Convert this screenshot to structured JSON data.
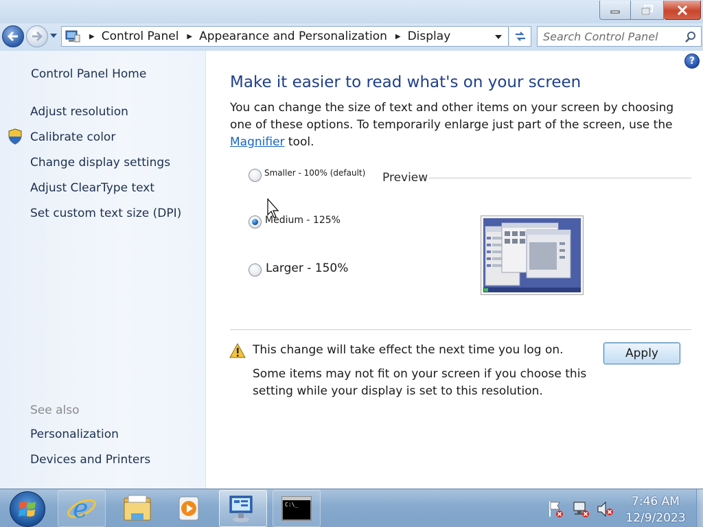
{
  "window": {
    "minimize_icon": "minimize-icon",
    "maximize_icon": "restore-icon",
    "close_icon": "close-icon"
  },
  "address_bar": {
    "breadcrumbs": [
      "Control Panel",
      "Appearance and Personalization",
      "Display"
    ],
    "search_placeholder": "Search Control Panel"
  },
  "sidebar": {
    "home": "Control Panel Home",
    "links": [
      "Adjust resolution",
      "Calibrate color",
      "Change display settings",
      "Adjust ClearType text",
      "Set custom text size (DPI)"
    ],
    "see_also_heading": "See also",
    "see_also_links": [
      "Personalization",
      "Devices and Printers"
    ]
  },
  "main": {
    "title": "Make it easier to read what's on your screen",
    "description_before": "You can change the size of text and other items on your screen by choosing one of these options. To temporarily enlarge just part of the screen, use the ",
    "description_link": "Magnifier",
    "description_after": " tool.",
    "options": [
      {
        "label": "Smaller - 100% (default)",
        "selected": false
      },
      {
        "label": "Medium - 125%",
        "selected": true
      },
      {
        "label": "Larger - 150%",
        "selected": false
      }
    ],
    "preview_label": "Preview",
    "warning": "This change will take effect the next time you log on.",
    "warning_detail": "Some items may not fit on your screen if you choose this setting while your display is set to this resolution.",
    "apply_label": "Apply"
  },
  "taskbar": {
    "time": "7:46 AM",
    "date": "12/9/2023",
    "apps": [
      "internet-explorer-icon",
      "windows-explorer-icon",
      "media-player-icon",
      "control-panel-icon",
      "command-prompt-icon"
    ]
  }
}
